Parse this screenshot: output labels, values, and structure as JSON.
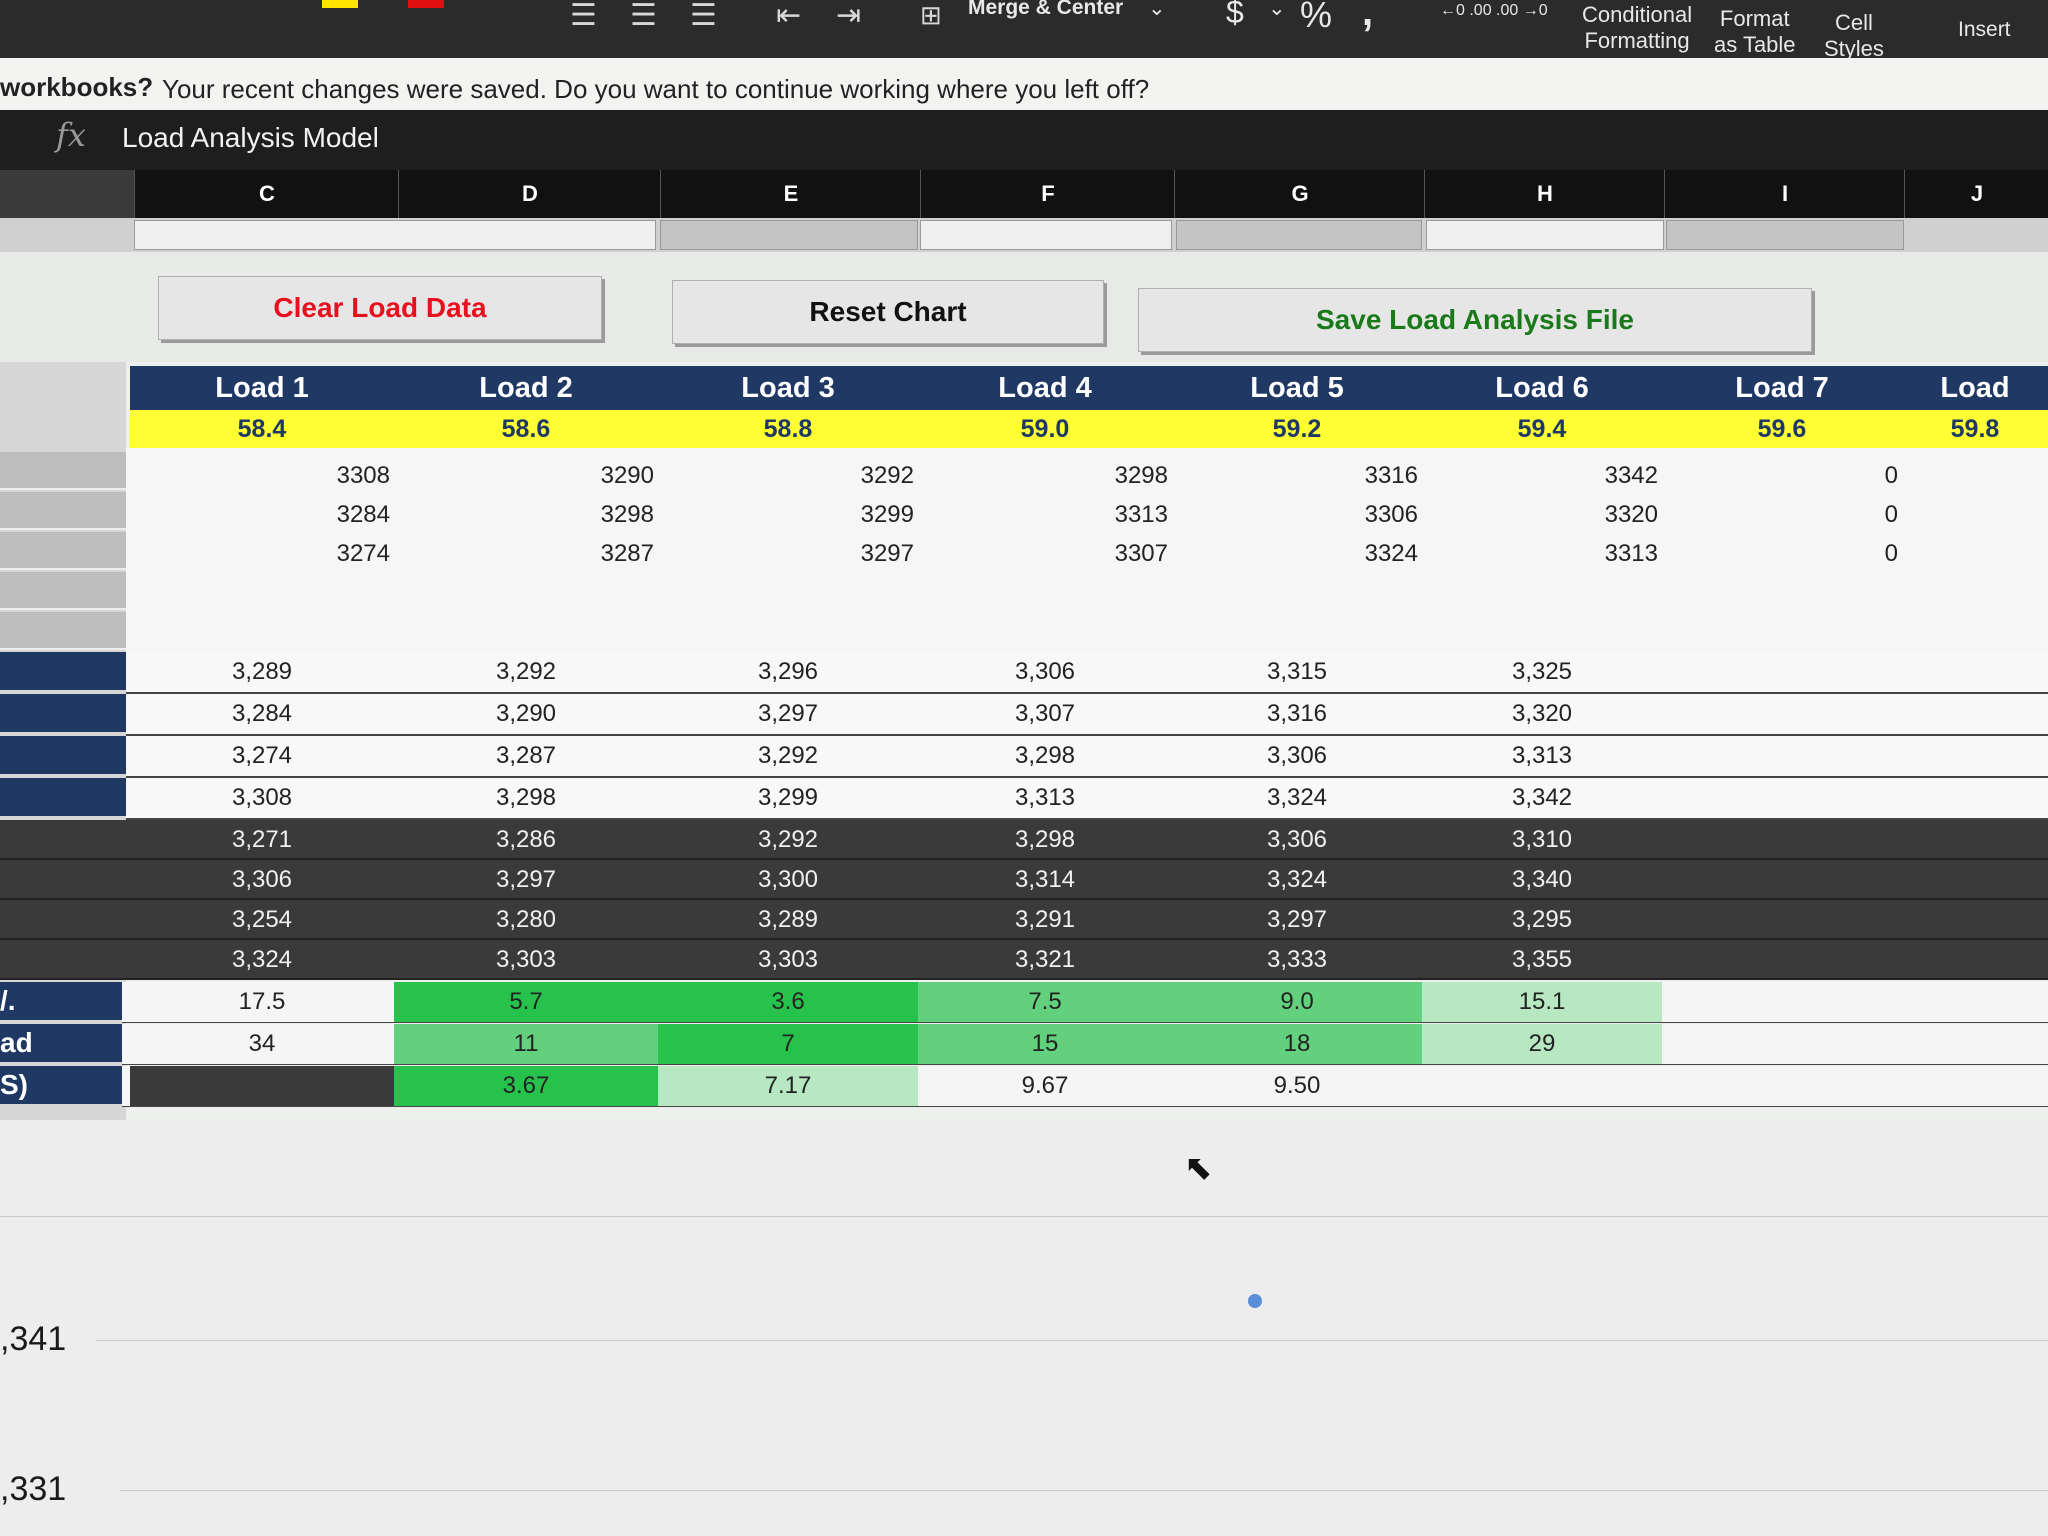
{
  "ribbon": {
    "merge_label": "Merge & Center",
    "dollar_icon": "$",
    "percent_icon": "%",
    "comma_icon": ",",
    "inc_decimal": "←0 .00",
    "dec_decimal": ".00 →0",
    "conditional_line1": "Conditional",
    "conditional_line2": "Formatting",
    "format_line1": "Format",
    "format_line2": "as Table",
    "cell_line1": "Cell",
    "cell_line2": "Styles",
    "insert_label": "Insert"
  },
  "infobar": {
    "bold": "workbooks?",
    "message": "Your recent changes were saved. Do you want to continue working where you left off?"
  },
  "formula_bar": {
    "fx": "fx",
    "value": "Load Analysis Model"
  },
  "columns": [
    "C",
    "D",
    "E",
    "F",
    "G",
    "H",
    "I",
    "J"
  ],
  "buttons": {
    "clear": "Clear Load Data",
    "reset": "Reset Chart",
    "save": "Save Load Analysis File"
  },
  "colors": {
    "header_blue": "#1f3864",
    "yellow": "#ffff33",
    "green_dark": "#27c24c",
    "green_mid": "#63d07d",
    "green_light": "#b7e8c2",
    "dark_row": "#3a3a3a",
    "clear_text": "#e8101f",
    "save_text": "#1a7a1a"
  },
  "loads": [
    {
      "name": "Load 1",
      "temp": "58.4",
      "raw": [
        "3308",
        "3284",
        "3274"
      ]
    },
    {
      "name": "Load 2",
      "temp": "58.6",
      "raw": [
        "3290",
        "3298",
        "3287"
      ]
    },
    {
      "name": "Load 3",
      "temp": "58.8",
      "raw": [
        "3292",
        "3299",
        "3297"
      ]
    },
    {
      "name": "Load 4",
      "temp": "59.0",
      "raw": [
        "3298",
        "3313",
        "3307"
      ]
    },
    {
      "name": "Load 5",
      "temp": "59.2",
      "raw": [
        "3316",
        "3306",
        "3324"
      ]
    },
    {
      "name": "Load 6",
      "temp": "59.4",
      "raw": [
        "3342",
        "3320",
        "3313"
      ]
    },
    {
      "name": "Load 7",
      "temp": "59.6",
      "raw": [
        "0",
        "0",
        "0"
      ]
    },
    {
      "name": "Load",
      "temp": "59.8",
      "raw": [
        "",
        "",
        ""
      ]
    }
  ],
  "summary_rows": [
    [
      "3,289",
      "3,292",
      "3,296",
      "3,306",
      "3,315",
      "3,325"
    ],
    [
      "3,284",
      "3,290",
      "3,297",
      "3,307",
      "3,316",
      "3,320"
    ],
    [
      "3,274",
      "3,287",
      "3,292",
      "3,298",
      "3,306",
      "3,313"
    ],
    [
      "3,308",
      "3,298",
      "3,299",
      "3,313",
      "3,324",
      "3,342"
    ]
  ],
  "dark_rows": [
    [
      "3,271",
      "3,286",
      "3,292",
      "3,298",
      "3,306",
      "3,310"
    ],
    [
      "3,306",
      "3,297",
      "3,300",
      "3,314",
      "3,324",
      "3,340"
    ],
    [
      "3,254",
      "3,280",
      "3,289",
      "3,291",
      "3,297",
      "3,295"
    ],
    [
      "3,324",
      "3,303",
      "3,303",
      "3,321",
      "3,333",
      "3,355"
    ]
  ],
  "stat_rows": [
    {
      "label": "/.",
      "values": [
        "17.5",
        "5.7",
        "3.6",
        "7.5",
        "9.0",
        "15.1"
      ]
    },
    {
      "label": "ad",
      "values": [
        "34",
        "11",
        "7",
        "15",
        "18",
        "29"
      ]
    },
    {
      "label": "S)",
      "values": [
        "",
        "3.67",
        "7.17",
        "9.67",
        "9.50",
        ""
      ]
    }
  ],
  "lower": {
    "value1": ",341",
    "value2": ",331"
  }
}
